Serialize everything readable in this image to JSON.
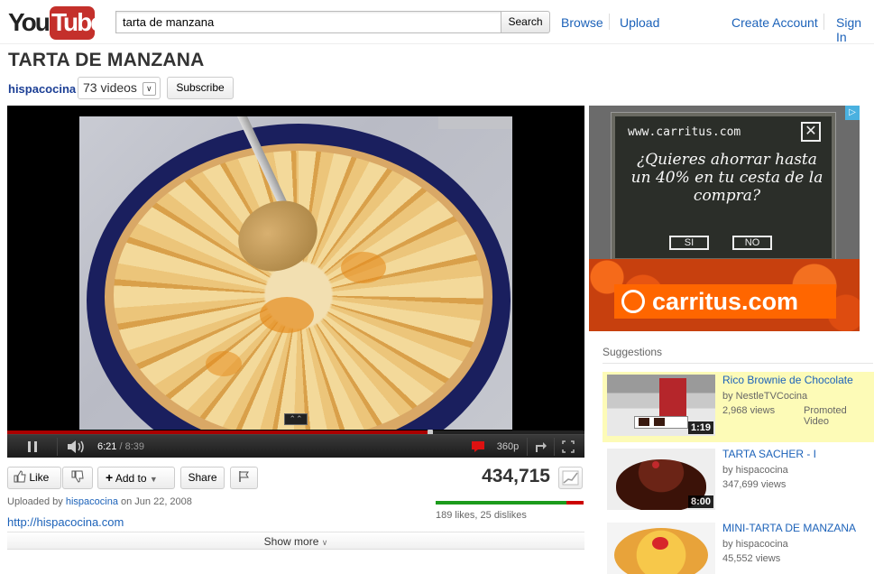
{
  "header": {
    "logo_you": "You",
    "logo_tube": "Tube",
    "search_value": "tarta de manzana",
    "search_button": "Search",
    "browse": "Browse",
    "upload": "Upload",
    "create_account": "Create Account",
    "sign_in": "Sign In"
  },
  "video": {
    "title": "TARTA DE MANZANA",
    "channel": "hispacocina",
    "videos_count": "73 videos",
    "subscribe": "Subscribe"
  },
  "player": {
    "current_time": "6:21",
    "duration": "/ 8:39",
    "quality": "360p",
    "progress_fraction": 0.733,
    "buffered_fraction": 0.755
  },
  "actions": {
    "like": "Like",
    "add_to": "Add to",
    "share": "Share",
    "view_count": "434,715"
  },
  "meta": {
    "uploaded_prefix": "Uploaded by",
    "uploader": "hispacocina",
    "uploaded_date": "on Jun 22, 2008",
    "url": "http://hispacocina.com",
    "likes_text": "189 likes, 25 dislikes",
    "like_fraction": 0.883,
    "show_more": "Show more"
  },
  "ad": {
    "url_text": "www.carritus.com",
    "question": "¿Quieres ahorrar hasta un 40% en tu cesta de la compra?",
    "yes": "SI",
    "no": "NO",
    "brand": "carritus.com"
  },
  "suggestions": {
    "heading": "Suggestions",
    "items": [
      {
        "title": "Rico Brownie de Chocolate",
        "by": "by NestleTVCocina",
        "views": "2,968 views",
        "promo": "Promoted Video",
        "duration": "1:19"
      },
      {
        "title": "TARTA SACHER - I",
        "by": "by hispacocina",
        "views": "347,699 views",
        "promo": "",
        "duration": "8:00"
      },
      {
        "title": "MINI-TARTA DE MANZANA",
        "by": "by hispacocina",
        "views": "45,552 views",
        "promo": "",
        "duration": ""
      }
    ]
  },
  "colors": {
    "link": "#1c62b9",
    "promoted_bg": "#fdfbb7",
    "like_green": "#1c9b1c",
    "dislike_red": "#cc0000",
    "ad_orange": "#ff6600"
  }
}
